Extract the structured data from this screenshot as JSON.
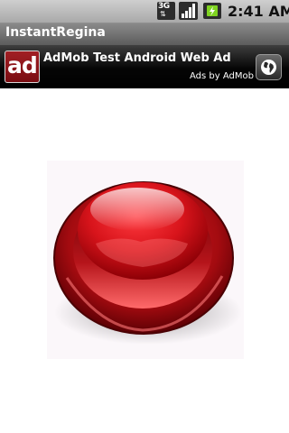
{
  "status_bar": {
    "network_type": "3G",
    "time": "2:41 AM",
    "icons": [
      "3g-data-icon",
      "signal-strength-icon",
      "battery-charging-icon"
    ]
  },
  "app": {
    "title": "InstantRegina"
  },
  "ad": {
    "logo_text": "ad",
    "headline": "AdMob Test Android Web Ad",
    "byline": "Ads by AdMob",
    "icon": "globe-icon"
  },
  "main": {
    "button_icon": "red-button"
  },
  "colors": {
    "ad_logo": "#8e161b",
    "button_red": "#d4121a",
    "title_bar": "#6e6e6e",
    "status_bar": "#b8b8b8"
  }
}
